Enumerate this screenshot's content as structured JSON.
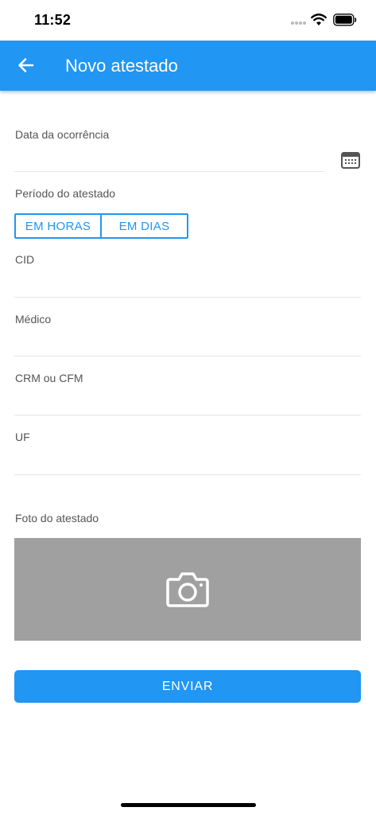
{
  "status_bar": {
    "time": "11:52",
    "icons": [
      "signal-dots-icon",
      "wifi-icon",
      "battery-icon"
    ]
  },
  "app_bar": {
    "title": "Novo atestado",
    "back_icon": "arrow-left-icon",
    "color": "#2196f3"
  },
  "form": {
    "date_field": {
      "label": "Data da ocorrência",
      "value": "",
      "icon": "calendar-icon"
    },
    "period_field": {
      "label": "Período do atestado",
      "options": [
        "EM HORAS",
        "EM DIAS"
      ]
    },
    "cid_field": {
      "label": "CID",
      "value": ""
    },
    "doctor_field": {
      "label": "Médico",
      "value": ""
    },
    "crm_field": {
      "label": "CRM ou CFM",
      "value": ""
    },
    "uf_field": {
      "label": "UF",
      "value": ""
    },
    "photo_field": {
      "label": "Foto do atestado",
      "icon": "camera-icon"
    },
    "submit_label": "ENVIAR"
  },
  "colors": {
    "primary": "#2196f3",
    "photo_background": "#a0a0a0",
    "divider": "#e6e6e6"
  }
}
